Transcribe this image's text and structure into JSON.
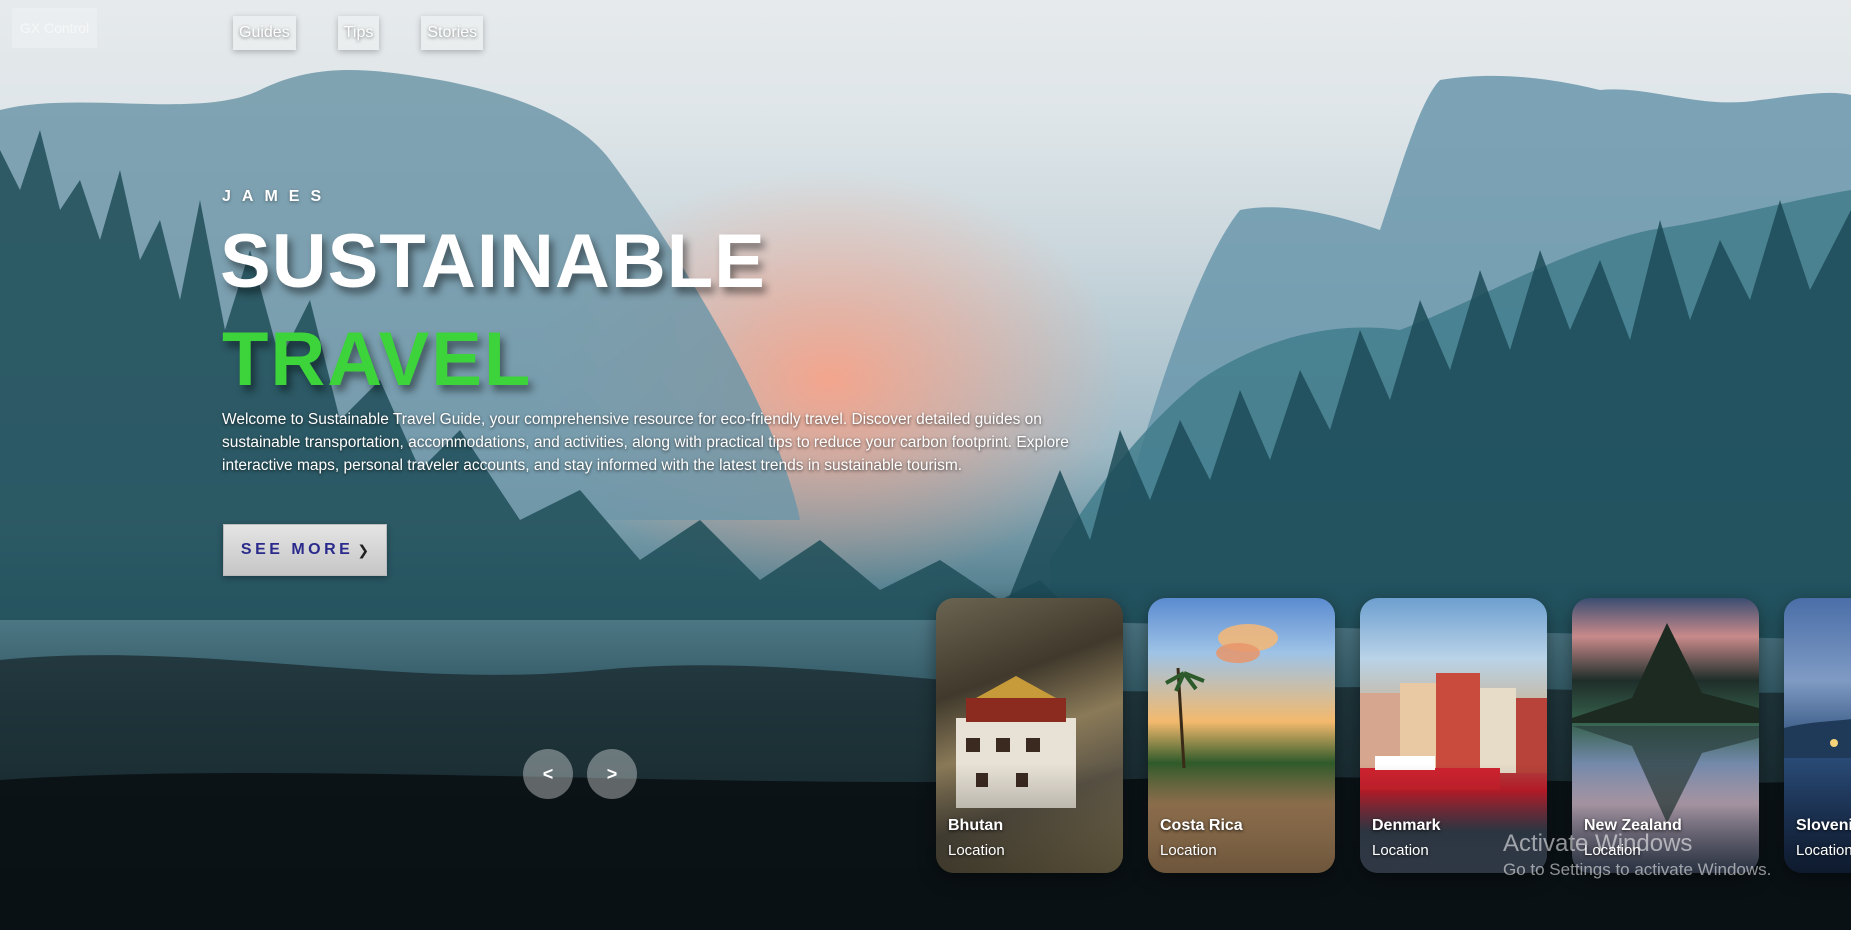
{
  "top_left_label": "GX Control",
  "nav": {
    "items": [
      "Guides",
      "Tips",
      "Stories"
    ]
  },
  "hero": {
    "author": "JAMES",
    "title_line1": "SUSTAINABLE",
    "title_line2": "TRAVEL",
    "title_line2_color": "#3dd43b",
    "description": "Welcome to Sustainable Travel Guide, your comprehensive resource for eco-friendly travel. Discover detailed guides on sustainable transportation, accommodations, and activities, along with practical tips to reduce your carbon footprint. Explore interactive maps, personal traveler accounts, and stay informed with the latest trends in sustainable tourism.",
    "cta_label": "SEE MORE",
    "cta_color": "#2a2a8c"
  },
  "slider": {
    "prev_symbol": "<",
    "next_symbol": ">"
  },
  "cards": [
    {
      "name": "Bhutan",
      "sub": "Location"
    },
    {
      "name": "Costa Rica",
      "sub": "Location"
    },
    {
      "name": "Denmark",
      "sub": "Location"
    },
    {
      "name": "New Zealand",
      "sub": "Location"
    },
    {
      "name": "Slovenia",
      "sub": "Location"
    }
  ],
  "watermark": {
    "title": "Activate Windows",
    "subtitle": "Go to Settings to activate Windows."
  }
}
